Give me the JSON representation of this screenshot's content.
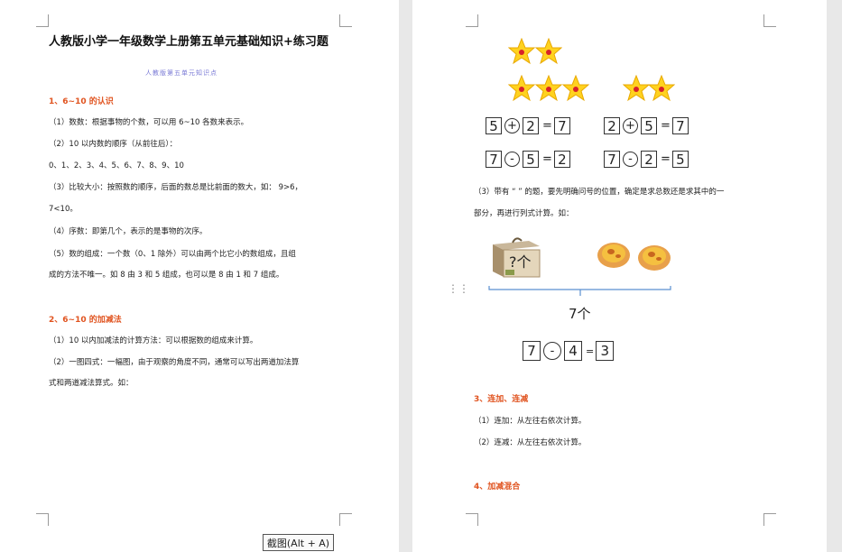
{
  "left_page": {
    "title": "人教版小学一年级数学上册第五单元基础知识+练习题",
    "subtitle": "人教版第五单元知识点",
    "section1": {
      "heading": "1、6~10 的认识",
      "lines": [
        "（1）数数：根据事物的个数，可以用 6~10 各数来表示。",
        "（2）10 以内数的顺序（从前往后）：",
        "0、1、2、3、4、5、6、7、8、9、10",
        "（3）比较大小：按照数的顺序，后面的数总是比前面的数大，如： 9>6，",
        "7<10。",
        "（4）序数：即第几个，表示的是事物的次序。",
        "（5）数的组成：一个数（0、1 除外）可以由两个比它小的数组成，且组",
        "成的方法不唯一。如 8 由 3 和 5 组成，也可以是 8 由 1 和 7 组成。"
      ]
    },
    "section2": {
      "heading": "2、6~10 的加减法",
      "lines": [
        "（1）10 以内加减法的计算方法：可以根据数的组成来计算。",
        "（2）一图四式：一幅图，由于观察的角度不同，通常可以写出两道加法算",
        "式和两道减法算式。如："
      ]
    }
  },
  "right_page": {
    "equations": [
      {
        "a": "5",
        "op": "+",
        "b": "2",
        "eq": "=",
        "r": "7"
      },
      {
        "a": "2",
        "op": "+",
        "b": "5",
        "eq": "=",
        "r": "7"
      },
      {
        "a": "7",
        "op": "-",
        "b": "5",
        "eq": "=",
        "r": "2"
      },
      {
        "a": "7",
        "op": "-",
        "b": "2",
        "eq": "=",
        "r": "5"
      }
    ],
    "section3_note": [
      "（3）带有 “ ” 的题，要先明确问号的位置，确定是求总数还是求其中的一",
      "部分，再进行列式计算。如："
    ],
    "box_label": "?个",
    "total_label": "7个",
    "example_eq": {
      "a": "7",
      "op": "-",
      "b": "4",
      "eq": "=",
      "r": "3"
    },
    "section3": {
      "heading": "3、连加、连减",
      "lines": [
        "（1）连加：从左往右依次计算。",
        "（2）连减：从左往右依次计算。"
      ]
    },
    "section4": {
      "heading": "4、加减混合"
    }
  },
  "screenshot_tooltip": "截图(Alt + A)",
  "colors": {
    "heading_orange": "#e0531f",
    "subtitle_blue": "#7b7bd6",
    "brace_blue": "#5b8fd0",
    "star_yellow": "#ffd21f"
  }
}
